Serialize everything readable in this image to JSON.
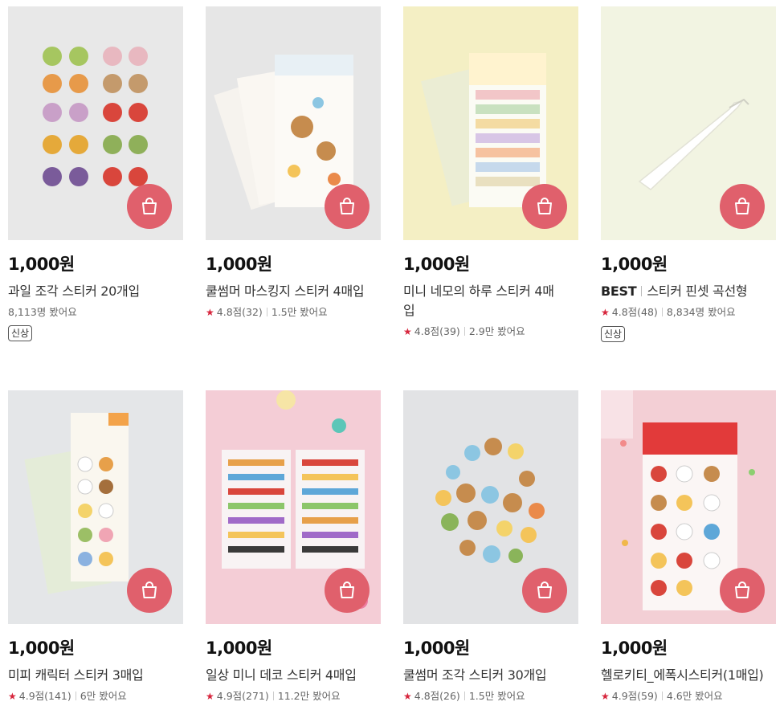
{
  "colors": {
    "accent": "#e0606c",
    "star": "#d7263d"
  },
  "icons": {
    "cart": "shopping-bag-icon",
    "rating": "star-icon"
  },
  "products": [
    {
      "price": "1,000원",
      "title": "과일 조각 스티커 20개입",
      "views": "8,113명 봤어요",
      "badge": "신상"
    },
    {
      "price": "1,000원",
      "title": "쿨썸머 마스킹지 스티커 4매입",
      "rating": "4.8점(32)",
      "views": "1.5만 봤어요"
    },
    {
      "price": "1,000원",
      "title_line1": "미니 네모의 하루 스티커 4매",
      "title_line2": "입",
      "rating": "4.8점(39)",
      "views": "2.9만 봤어요"
    },
    {
      "price": "1,000원",
      "best": "BEST",
      "title": "스티커 핀셋 곡선형",
      "rating": "4.8점(48)",
      "views": "8,834명 봤어요",
      "badge": "신상"
    },
    {
      "price": "1,000원",
      "title": "미피 캐릭터 스티커 3매입",
      "rating": "4.9점(141)",
      "views": "6만 봤어요"
    },
    {
      "price": "1,000원",
      "title": "일상 미니 데코 스티커 4매입",
      "rating": "4.9점(271)",
      "views": "11.2만 봤어요"
    },
    {
      "price": "1,000원",
      "title": "쿨썸머 조각 스티커 30개입",
      "rating": "4.8점(26)",
      "views": "1.5만 봤어요"
    },
    {
      "price": "1,000원",
      "title": "헬로키티_에폭시스티커(1매입)",
      "rating": "4.9점(59)",
      "views": "4.6만 봤어요"
    }
  ]
}
